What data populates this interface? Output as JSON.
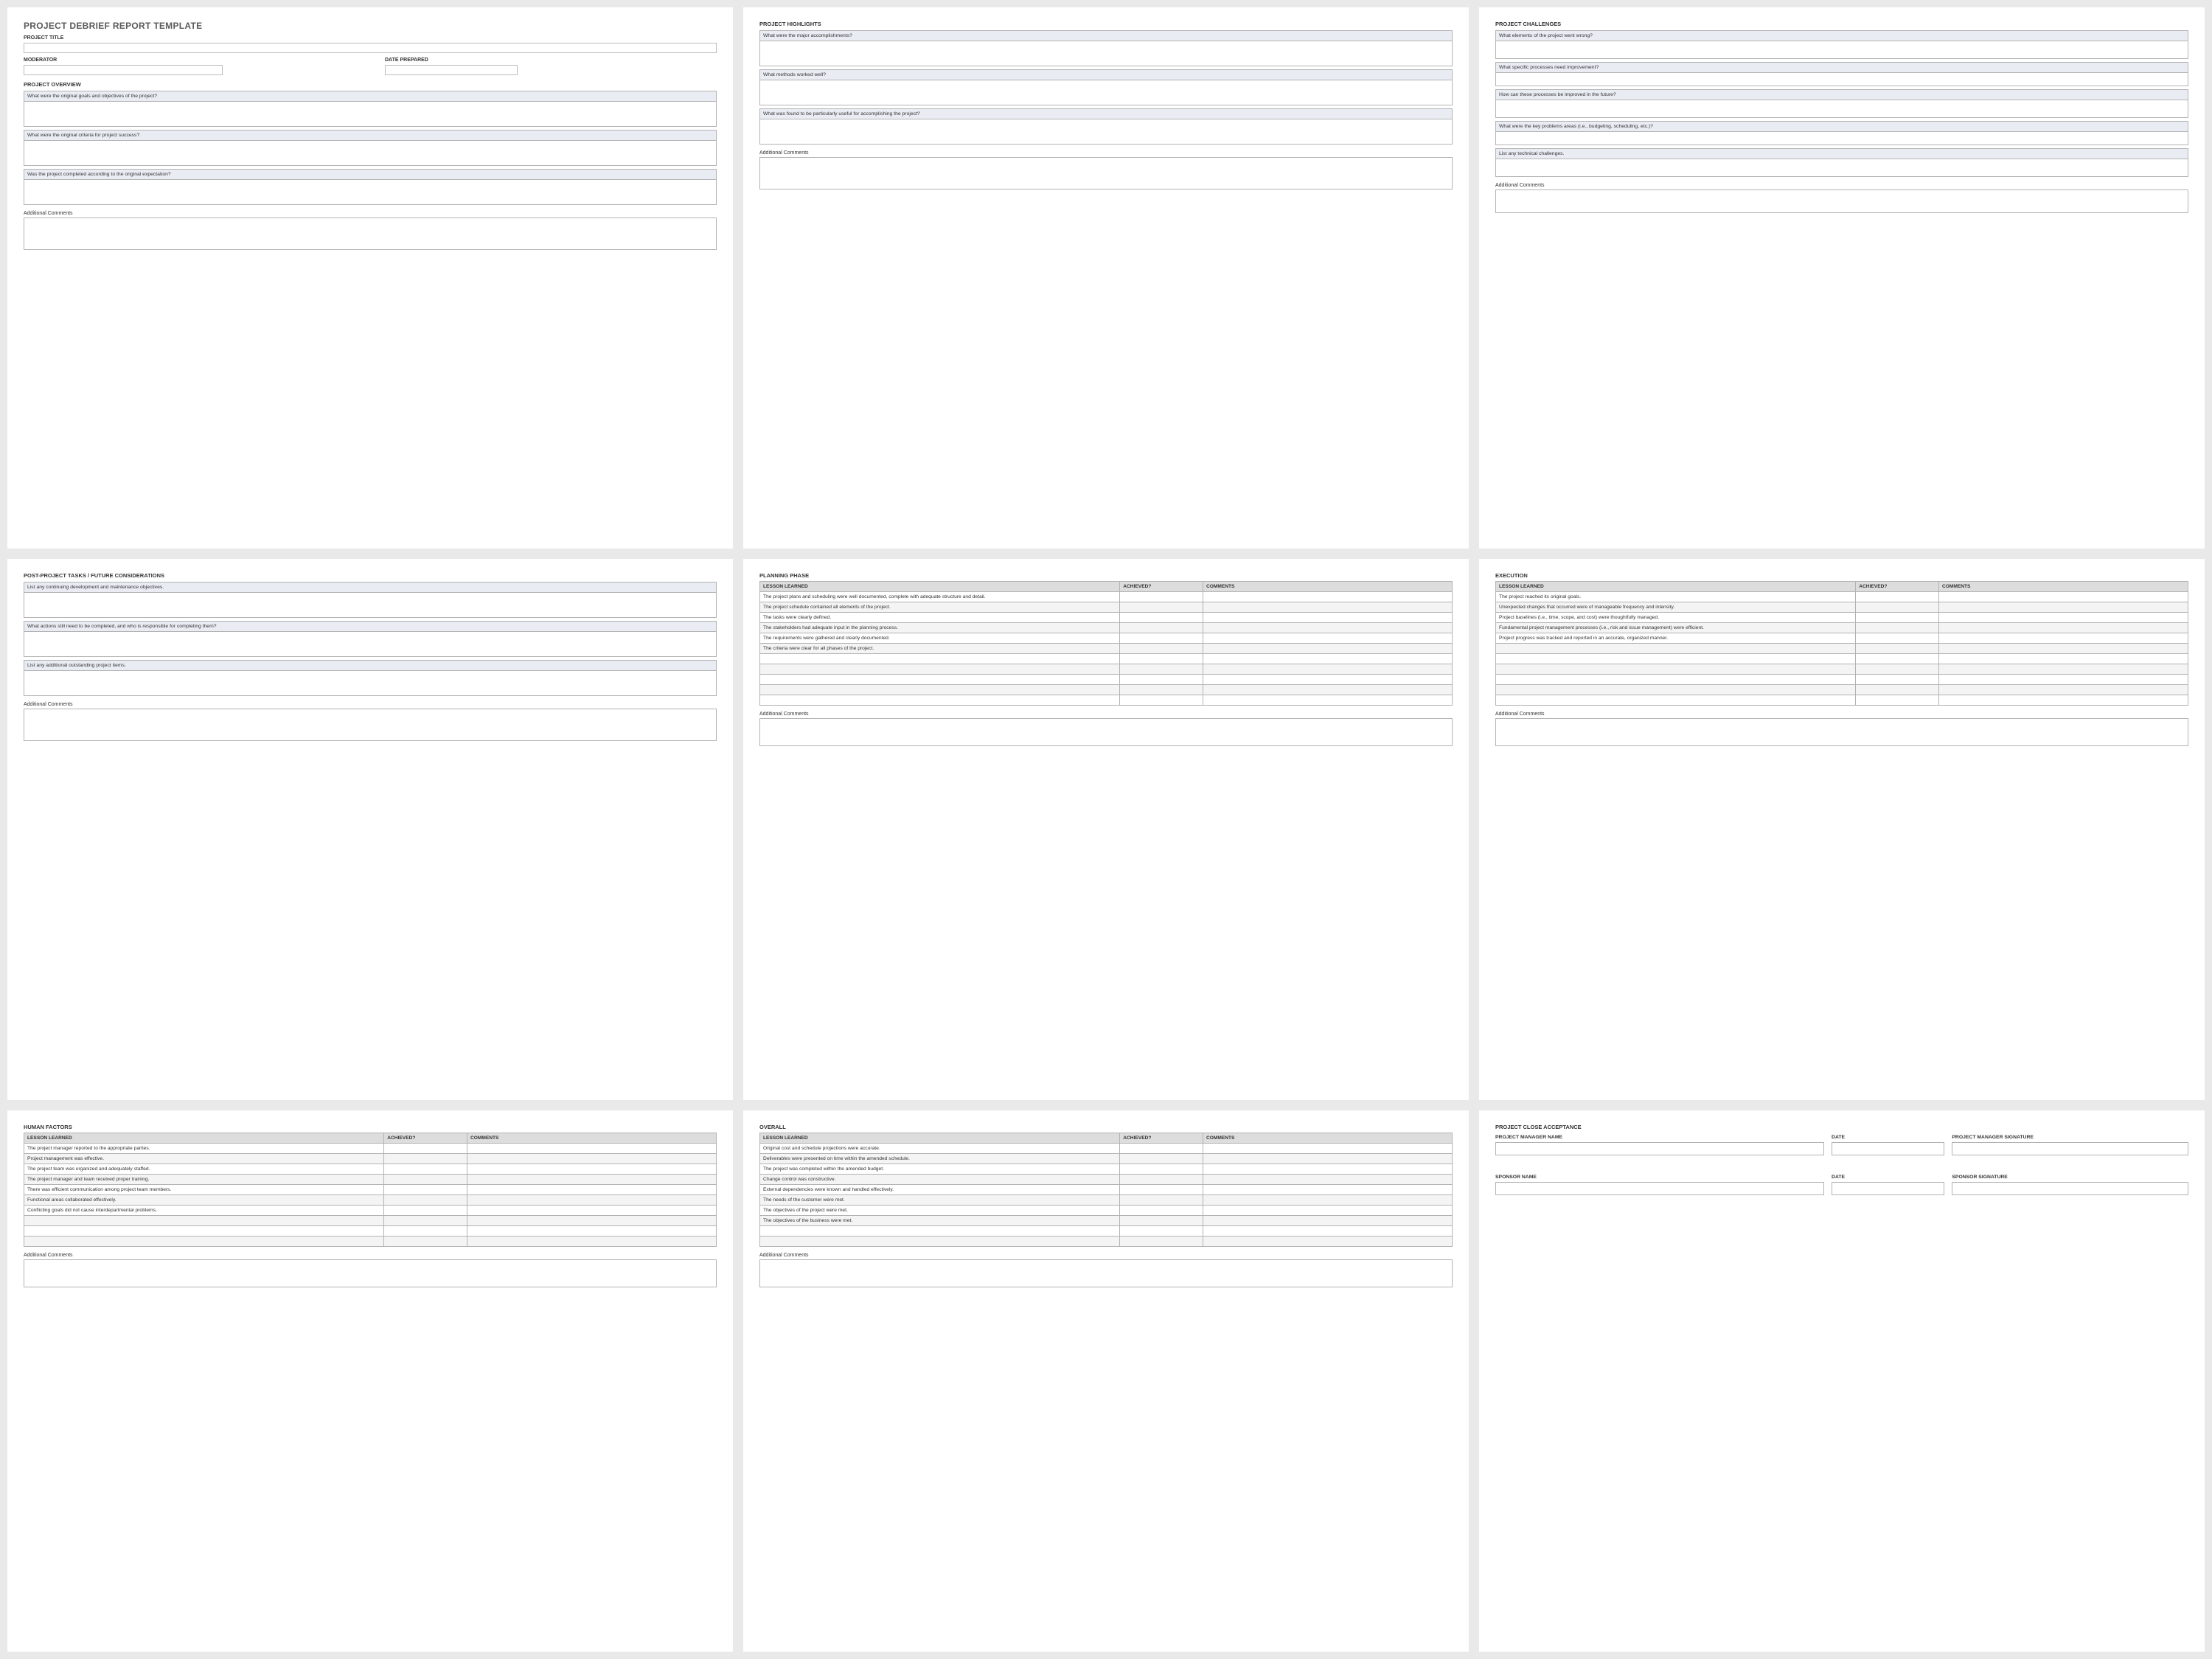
{
  "title": "PROJECT DEBRIEF REPORT TEMPLATE",
  "fields": {
    "project_title": "PROJECT TITLE",
    "moderator": "MODERATOR",
    "date_prepared": "DATE PREPARED"
  },
  "sections": {
    "overview": {
      "heading": "PROJECT OVERVIEW",
      "q": [
        "What were the original goals and objectives of the project?",
        "What were the original criteria for project success?",
        "Was the project completed according to the original expectation?"
      ]
    },
    "highlights": {
      "heading": "PROJECT HIGHLIGHTS",
      "q": [
        "What were the major accomplishments?",
        "What methods worked well?",
        "What was found to be particularly useful for accomplishing the project?"
      ]
    },
    "challenges": {
      "heading": "PROJECT CHALLENGES",
      "q": [
        "What elements of the project went wrong?",
        "What specific processes need improvement?",
        "How can these processes be improved in the future?",
        "What were the key problems areas (i.e., budgeting, scheduling, etc.)?",
        "List any technical challenges."
      ]
    },
    "post": {
      "heading": "POST-PROJECT TASKS / FUTURE CONSIDERATIONS",
      "q": [
        "List any continuing development and maintenance objectives.",
        "What actions still need to be completed, and who is responsible for completing them?",
        "List any additional outstanding project items."
      ]
    }
  },
  "additional_comments": "Additional Comments",
  "table_headers": {
    "lesson": "LESSON LEARNED",
    "achieved": "ACHIEVED?",
    "comments": "COMMENTS"
  },
  "planning": {
    "heading": "PLANNING PHASE",
    "rows": [
      "The project plans and scheduling were well documented, complete with adequate structure and detail.",
      "The project schedule contained all elements of the project.",
      "The tasks were clearly defined.",
      "The stakeholders had adequate input in the planning process.",
      "The requirements were gathered and clearly documented.",
      "The criteria were clear for all phases of the project.",
      "",
      "",
      "",
      "",
      ""
    ]
  },
  "execution": {
    "heading": "EXECUTION",
    "rows": [
      "The project reached its original goals.",
      "Unexpected changes that occurred were of manageable frequency and intensity.",
      "Project baselines (i.e., time, scope, and cost) were thoughtfully managed.",
      "Fundamental project management processes (i.e., risk and issue management) were efficient.",
      "Project progress was tracked and reported in an accurate, organized manner.",
      "",
      "",
      "",
      "",
      "",
      ""
    ]
  },
  "human_factors": {
    "heading": "HUMAN FACTORS",
    "rows": [
      "The project manager reported to the appropriate parties.",
      "Project management was effective.",
      "The project team was organized and adequately staffed.",
      "The project manager and team received proper training.",
      "There was efficient communication among project team members.",
      "Functional areas collaborated effectively.",
      "Conflicting goals did not cause interdepartmental problems.",
      "",
      "",
      ""
    ]
  },
  "overall": {
    "heading": "OVERALL",
    "rows": [
      "Original cost and schedule projections were accurate.",
      "Deliverables were presented on time within the amended schedule.",
      "The project was completed within the amended budget.",
      "Change control was constructive.",
      "External dependencies were known and handled effectively.",
      "The needs of the customer were met.",
      "The objectives of the project were met.",
      "The objectives of the business were met.",
      "",
      ""
    ]
  },
  "acceptance": {
    "heading": "PROJECT CLOSE ACCEPTANCE",
    "pm_name": "PROJECT MANAGER NAME",
    "date": "DATE",
    "pm_sig": "PROJECT MANAGER SIGNATURE",
    "sp_name": "SPONSOR NAME",
    "sp_sig": "SPONSOR SIGNATURE"
  }
}
